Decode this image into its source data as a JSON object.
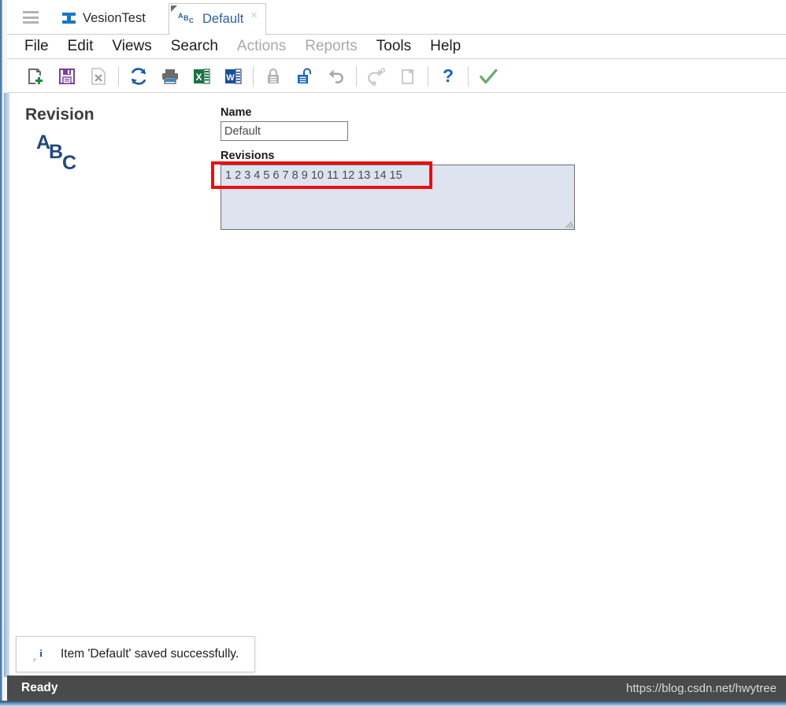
{
  "window": {
    "hamburger_icon": "hamburger-menu-icon"
  },
  "tabs": [
    {
      "label": "VesionTest",
      "icon": "ibeam-icon",
      "active": false,
      "closable": false
    },
    {
      "label": "Default",
      "icon": "abc-icon",
      "active": true,
      "closable": true,
      "close_glyph": "×"
    }
  ],
  "menubar": {
    "items": [
      {
        "label": "File",
        "disabled": false
      },
      {
        "label": "Edit",
        "disabled": false
      },
      {
        "label": "Views",
        "disabled": false
      },
      {
        "label": "Search",
        "disabled": false
      },
      {
        "label": "Actions",
        "disabled": true
      },
      {
        "label": "Reports",
        "disabled": true
      },
      {
        "label": "Tools",
        "disabled": false
      },
      {
        "label": "Help",
        "disabled": false
      }
    ]
  },
  "toolbar": {
    "buttons": [
      {
        "name": "new-button",
        "icon": "new-document-icon",
        "disabled": false
      },
      {
        "name": "save-button",
        "icon": "save-icon",
        "disabled": false
      },
      {
        "name": "delete-button",
        "icon": "delete-icon",
        "disabled": true
      },
      {
        "name": "refresh-button",
        "icon": "refresh-icon",
        "disabled": false
      },
      {
        "name": "print-button",
        "icon": "print-icon",
        "disabled": false
      },
      {
        "name": "excel-button",
        "icon": "excel-export-icon",
        "disabled": false
      },
      {
        "name": "word-button",
        "icon": "word-export-icon",
        "disabled": false
      },
      {
        "name": "lock-button",
        "icon": "lock-icon",
        "disabled": true
      },
      {
        "name": "unlock-button",
        "icon": "unlock-icon",
        "disabled": false
      },
      {
        "name": "undo-button",
        "icon": "undo-icon",
        "disabled": true
      },
      {
        "name": "redo-button",
        "icon": "redo-icon",
        "disabled": true
      },
      {
        "name": "copy-button",
        "icon": "copy-icon",
        "disabled": true
      },
      {
        "name": "help-button",
        "icon": "help-question-icon",
        "disabled": false
      },
      {
        "name": "apply-button",
        "icon": "checkmark-icon",
        "disabled": false
      }
    ]
  },
  "content": {
    "section_title": "Revision",
    "record_icon": "abc-icon",
    "abc_letters": {
      "a": "A",
      "b": "B",
      "c": "C"
    },
    "fields": {
      "name": {
        "label": "Name",
        "value": "Default",
        "placeholder": ""
      },
      "revisions": {
        "label": "Revisions",
        "value": "1 2 3 4 5 6 7 8 9 10 11 12 13 14 15",
        "placeholder": ""
      }
    },
    "annotation": {
      "type": "red-rectangle-highlight",
      "target": "revisions-textarea-first-line",
      "color": "#ee0d0d"
    }
  },
  "toast": {
    "icon": "info-icon",
    "message": "Item 'Default' saved successfully."
  },
  "statusbar": {
    "status": "Ready",
    "watermark": "https://blog.csdn.net/hwytree"
  },
  "colors": {
    "accent_blue": "#2f5f9e",
    "brand_blue": "#1878c4",
    "highlight_red": "#ee0d0d",
    "statusbar_bg": "#4a4a4a",
    "textarea_bg": "#dde3ef"
  }
}
